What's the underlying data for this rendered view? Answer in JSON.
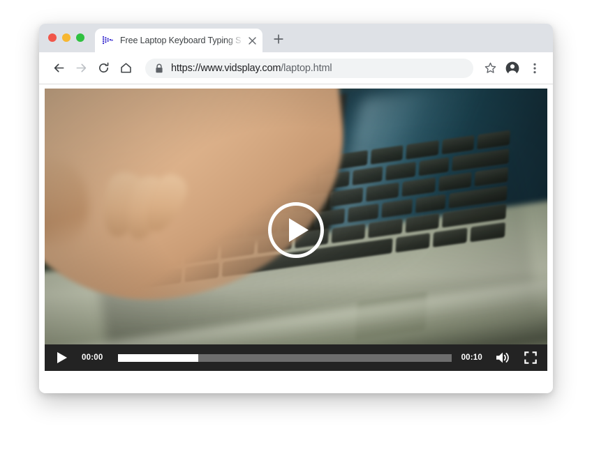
{
  "window": {
    "controls": [
      {
        "name": "close",
        "color": "#f1564a"
      },
      {
        "name": "minimize",
        "color": "#f7b731"
      },
      {
        "name": "maximize",
        "color": "#2fc140"
      }
    ]
  },
  "tab": {
    "title": "Free Laptop Keyboard Typing S",
    "favicon": "video-play-dots-icon",
    "close_label": "×",
    "new_tab_label": "+"
  },
  "toolbar": {
    "back_label": "back-arrow-icon",
    "forward_label": "forward-arrow-icon",
    "reload_label": "reload-icon",
    "home_label": "home-icon",
    "bookmark_label": "star-icon",
    "profile_label": "account-icon",
    "menu_label": "three-dot-menu-icon"
  },
  "omnibox": {
    "security_icon": "lock-icon",
    "url_scheme_host": "https://www.vidsplay.com",
    "url_path": "/laptop.html"
  },
  "video": {
    "poster_description": "Hand typing on a dark laptop keyboard",
    "big_play_icon": "play-circle-icon",
    "controls": {
      "play_icon": "play-icon",
      "current_time": "00:00",
      "duration": "00:10",
      "progress_percent": 24,
      "volume_icon": "volume-high-icon",
      "fullscreen_icon": "fullscreen-icon"
    }
  },
  "colors": {
    "tab_strip": "#dee1e6",
    "omnibox_bg": "#f1f3f4",
    "control_bar_bg": "#232323",
    "progress_fill": "#ffffff",
    "progress_track": "#6d6d6d"
  }
}
